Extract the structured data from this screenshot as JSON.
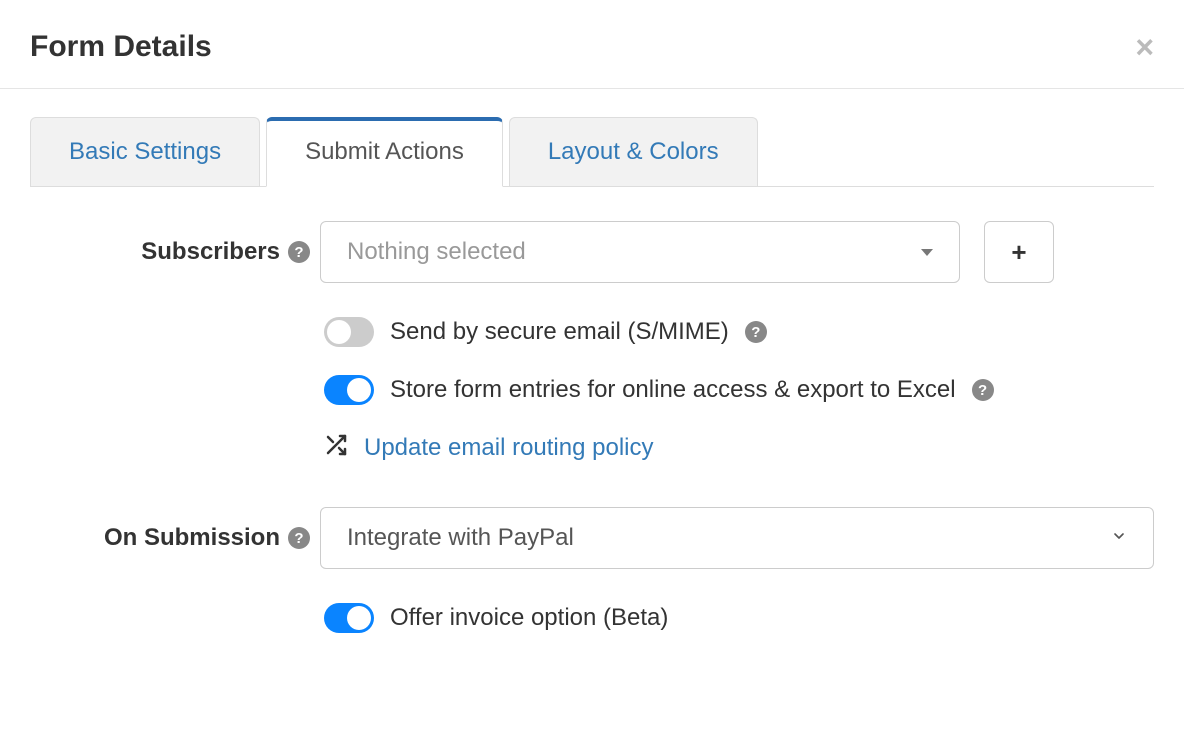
{
  "header": {
    "title": "Form Details"
  },
  "tabs": {
    "basic": "Basic Settings",
    "submit": "Submit Actions",
    "layout": "Layout & Colors"
  },
  "subscribers": {
    "label": "Subscribers",
    "placeholder": "Nothing selected"
  },
  "options": {
    "secure_email": "Send by secure email (S/MIME)",
    "store_entries": "Store form entries for online access & export to Excel",
    "routing_link": "Update email routing policy",
    "invoice_option": "Offer invoice option (Beta)"
  },
  "on_submission": {
    "label": "On Submission",
    "selected": "Integrate with PayPal"
  }
}
